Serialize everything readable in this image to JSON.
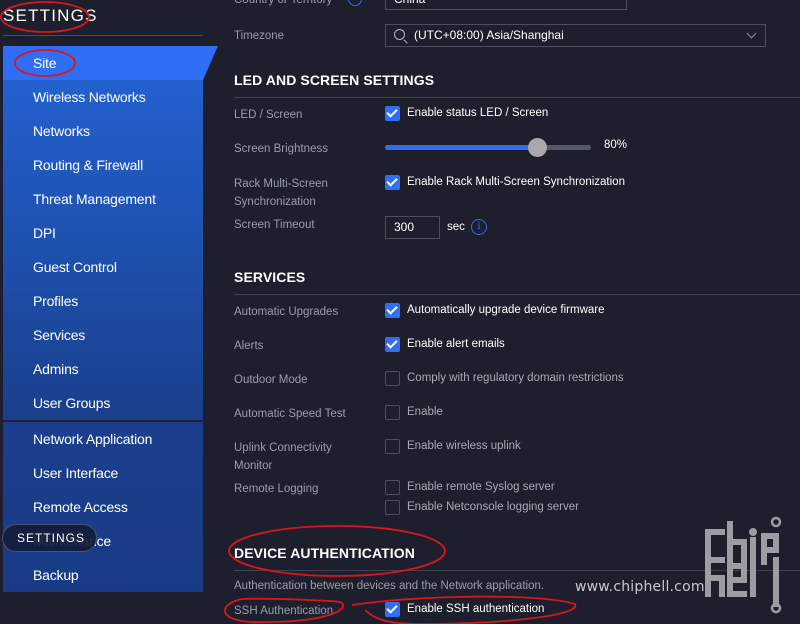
{
  "sidebar": {
    "title": "SETTINGS",
    "group1": [
      {
        "label": "Site",
        "active": true
      },
      {
        "label": "Wireless Networks"
      },
      {
        "label": "Networks"
      },
      {
        "label": "Routing & Firewall"
      },
      {
        "label": "Threat Management"
      },
      {
        "label": "DPI"
      },
      {
        "label": "Guest Control"
      },
      {
        "label": "Profiles"
      },
      {
        "label": "Services"
      },
      {
        "label": "Admins"
      },
      {
        "label": "User Groups"
      }
    ],
    "group2": [
      {
        "label": "Network Application"
      },
      {
        "label": "User Interface"
      },
      {
        "label": "Remote Access"
      },
      {
        "label": "Maintenance"
      },
      {
        "label": "Backup"
      }
    ],
    "overlay_pill": "SETTINGS"
  },
  "main": {
    "country": {
      "label": "Country or Territory",
      "value": "China"
    },
    "timezone": {
      "label": "Timezone",
      "value": "(UTC+08:00) Asia/Shanghai"
    },
    "led_section": {
      "title": "LED AND SCREEN SETTINGS",
      "led_screen": {
        "label": "LED / Screen",
        "option": "Enable status LED / Screen",
        "checked": true
      },
      "brightness": {
        "label": "Screen Brightness",
        "value_percent": 80,
        "display": "80%"
      },
      "rack_sync": {
        "label_line1": "Rack Multi-Screen",
        "label_line2": "Synchronization",
        "option": "Enable Rack Multi-Screen Synchronization",
        "checked": true
      },
      "timeout": {
        "label": "Screen Timeout",
        "value": "300",
        "unit": "sec"
      }
    },
    "services_section": {
      "title": "SERVICES",
      "auto_upgrades": {
        "label": "Automatic Upgrades",
        "option": "Automatically upgrade device firmware",
        "checked": true
      },
      "alerts": {
        "label": "Alerts",
        "option": "Enable alert emails",
        "checked": true
      },
      "outdoor_mode": {
        "label": "Outdoor Mode",
        "option": "Comply with regulatory domain restrictions",
        "checked": false
      },
      "speed_test": {
        "label": "Automatic Speed Test",
        "option": "Enable",
        "checked": false
      },
      "uplink": {
        "label_line1": "Uplink Connectivity",
        "label_line2": "Monitor",
        "option": "Enable wireless uplink",
        "checked": false
      },
      "remote_logging": {
        "label": "Remote Logging",
        "option1": "Enable remote Syslog server",
        "option1_checked": false,
        "option2": "Enable Netconsole logging server",
        "option2_checked": false
      }
    },
    "device_auth_section": {
      "title": "DEVICE AUTHENTICATION",
      "description": "Authentication between devices and the Network application.",
      "ssh": {
        "label": "SSH Authentication",
        "option": "Enable SSH authentication",
        "checked": true
      }
    }
  },
  "watermark": {
    "text": "www.chiphell.com",
    "logo_line1": "chip",
    "logo_line2": "hell"
  },
  "colors": {
    "accent": "#2f6ef5",
    "background": "#1d1f2c",
    "annotation": "#d9161c"
  }
}
